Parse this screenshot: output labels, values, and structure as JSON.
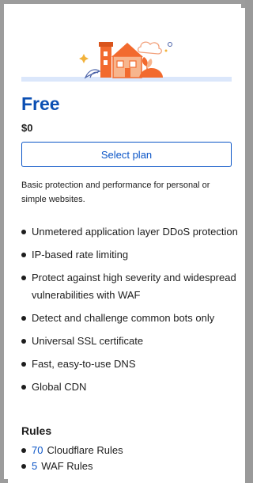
{
  "plan": {
    "name": "Free",
    "price": "$0",
    "select_label": "Select plan",
    "description": "Basic protection and performance for personal or simple websites."
  },
  "features": [
    "Unmetered application layer DDoS protection",
    "IP-based rate limiting",
    "Protect against high severity and widespread vulnerabilities with WAF",
    "Detect and challenge common bots only",
    "Universal SSL certificate",
    "Fast, easy-to-use DNS",
    "Global CDN"
  ],
  "rules": {
    "heading": "Rules",
    "items": [
      {
        "count": "70",
        "label": "Cloudflare Rules"
      },
      {
        "count": "5",
        "label": "WAF Rules"
      }
    ]
  },
  "colors": {
    "accent": "#0b55c7",
    "title": "#0b4fb3",
    "illustration_orange": "#f26a2e",
    "illustration_peach": "#f7b58d",
    "illustration_bar": "#dbe7fb"
  }
}
